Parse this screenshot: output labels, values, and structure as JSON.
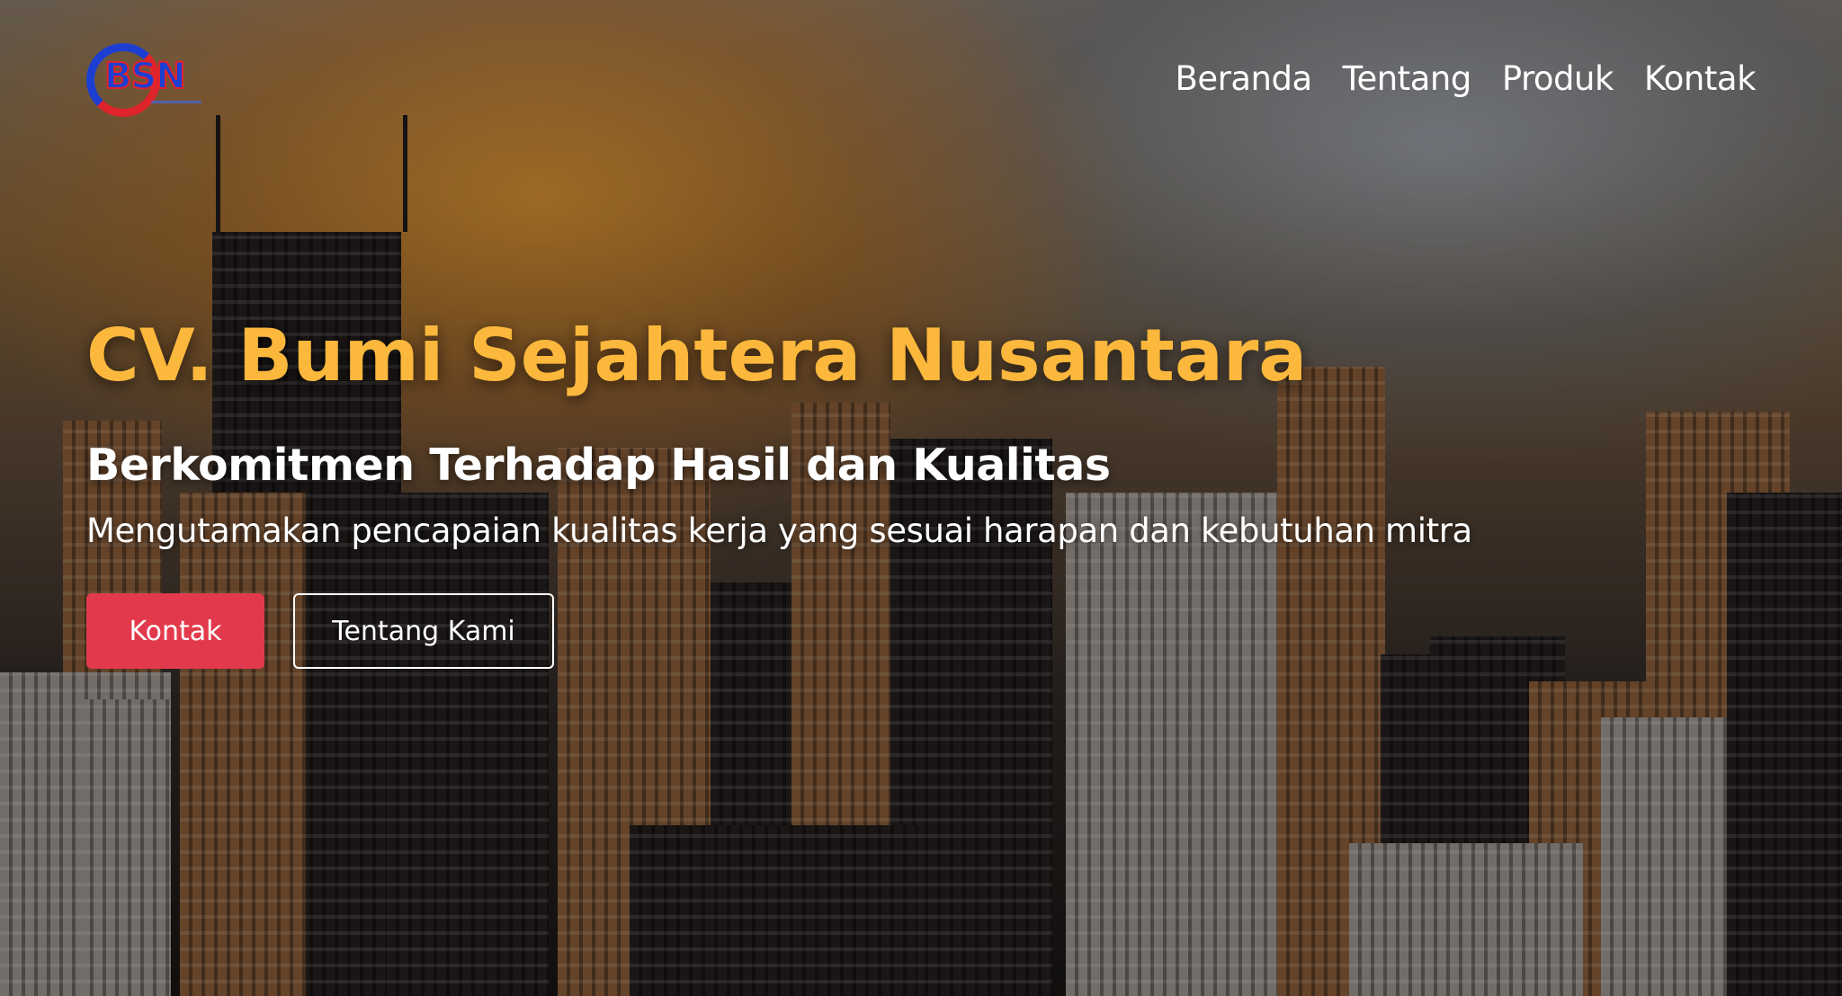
{
  "brand": {
    "logo_text": "BSN",
    "logo_colors": {
      "primary": "#1d3fd1",
      "accent": "#e0242c"
    }
  },
  "nav": {
    "items": [
      {
        "label": "Beranda"
      },
      {
        "label": "Tentang"
      },
      {
        "label": "Produk"
      },
      {
        "label": "Kontak"
      }
    ]
  },
  "hero": {
    "title": "CV. Bumi Sejahtera Nusantara",
    "subtitle": "Berkomitmen Terhadap Hasil dan Kualitas",
    "tagline": "Mengutamakan pencapaian kualitas kerja yang sesuai harapan dan kebutuhan mitra",
    "primary_button": "Kontak",
    "secondary_button": "Tentang Kami",
    "background_image": "city-skyline-at-sunset"
  },
  "colors": {
    "title": "#fbb83c",
    "primary_button": "#e23a4c",
    "text": "#ffffff"
  }
}
